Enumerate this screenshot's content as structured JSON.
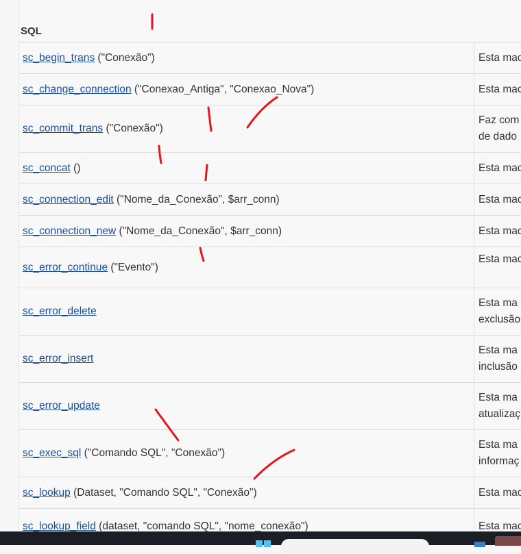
{
  "section": {
    "title": "SQL"
  },
  "rows": [
    {
      "name": "sc_begin_trans",
      "params": " (\"Conexão\")",
      "desc": [
        "Esta mac"
      ],
      "height": 46
    },
    {
      "name": "sc_change_connection",
      "params": " (\"Conexao_Antiga\", \"Conexao_Nova\")",
      "desc": [
        "Esta mac"
      ],
      "height": 46
    },
    {
      "name": "sc_commit_trans",
      "params": " (\"Conexão\")",
      "desc": [
        "Faz com",
        "de dado"
      ],
      "height": 69
    },
    {
      "name": "sc_concat",
      "params": " ()",
      "desc": [
        "Esta mac"
      ],
      "height": 46
    },
    {
      "name": "sc_connection_edit",
      "params": " (\"Nome_da_Conexão\", $arr_conn)",
      "desc": [
        "Esta mac"
      ],
      "height": 46
    },
    {
      "name": "sc_connection_new",
      "params": " (\"Nome_da_Conexão\", $arr_conn)",
      "desc": [
        "Esta mac"
      ],
      "height": 46
    },
    {
      "name": "sc_error_continue",
      "params": " (\"Evento\")",
      "desc": [
        "Esta mac",
        ""
      ],
      "height": 60
    },
    {
      "name": "sc_error_delete",
      "params": "",
      "desc": [
        "Esta ma",
        "exclusão"
      ],
      "height": 69
    },
    {
      "name": "sc_error_insert",
      "params": "",
      "desc": [
        "Esta ma",
        "inclusão"
      ],
      "height": 69
    },
    {
      "name": "sc_error_update",
      "params": "",
      "desc": [
        "Esta ma",
        "atualizaç"
      ],
      "height": 69
    },
    {
      "name": "sc_exec_sql",
      "params": " (\"Comando SQL\", \"Conexão\")",
      "desc": [
        "Esta ma",
        "informaç"
      ],
      "height": 69
    },
    {
      "name": "sc_lookup",
      "params": " (Dataset, \"Comando SQL\", \"Conexão\")",
      "desc": [
        "Esta mac"
      ],
      "height": 46
    },
    {
      "name": "sc_lookup_field",
      "params": " (dataset, \"comando SQL\", \"nome_conexão\")",
      "desc": [
        "Esta mac"
      ],
      "height": 40
    }
  ],
  "colors": {
    "link": "#1a4f9c",
    "annotation": "#e8131e",
    "taskbar": "#1b1f25"
  }
}
